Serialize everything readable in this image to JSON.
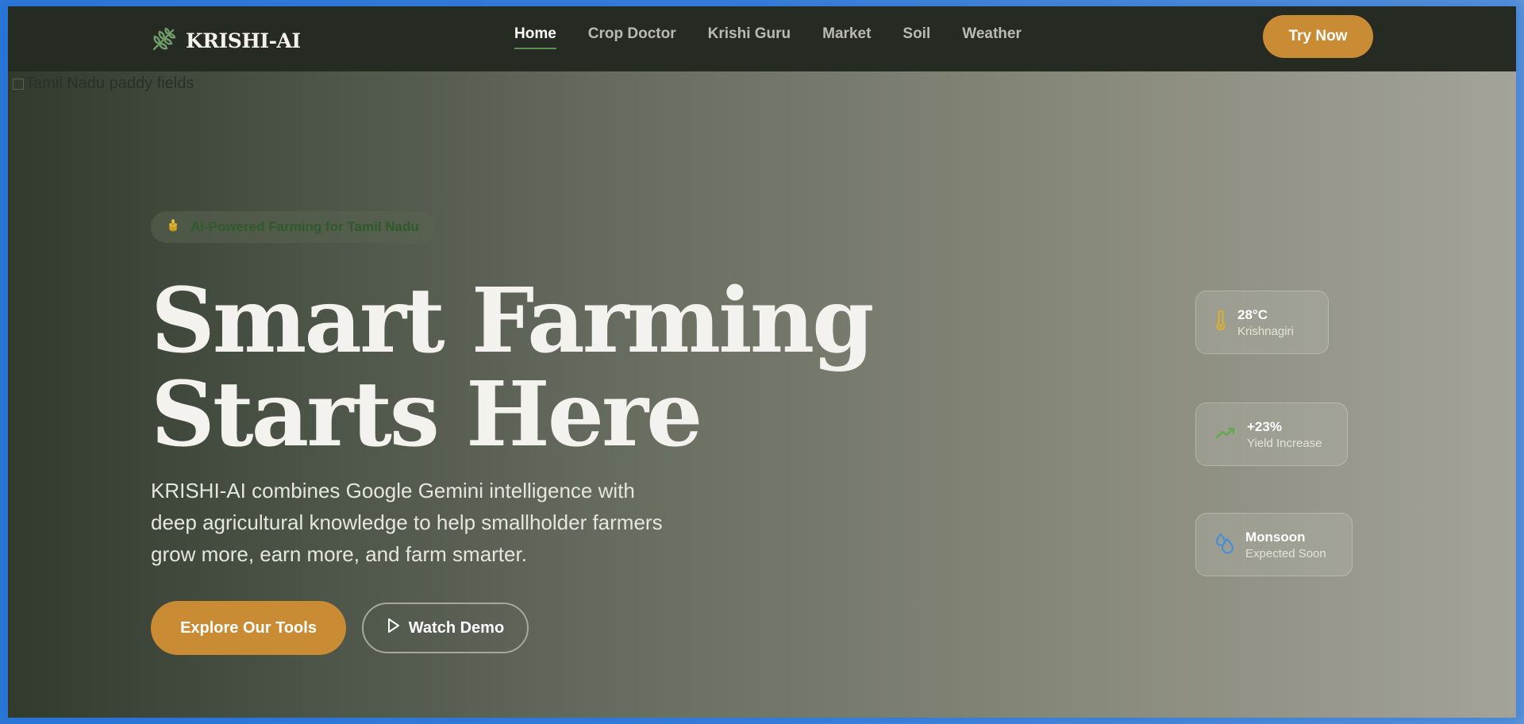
{
  "brand": {
    "name": "KRISHI-AI",
    "accent": "#c98c34",
    "green": "#5c8f4d",
    "nav_bg": "#252a22"
  },
  "nav": {
    "links": [
      {
        "label": "Home",
        "active": true
      },
      {
        "label": "Crop Doctor",
        "active": false
      },
      {
        "label": "Krishi Guru",
        "active": false
      },
      {
        "label": "Market",
        "active": false
      },
      {
        "label": "Soil",
        "active": false
      },
      {
        "label": "Weather",
        "active": false
      }
    ],
    "cta": "Try Now"
  },
  "hero_image_alt": "Tamil Nadu paddy fields",
  "hero": {
    "badge": "AI-Powered Farming for Tamil Nadu",
    "badge_icon": "wheat-icon",
    "headline_line1": "Smart Farming",
    "headline_line2": "Starts Here",
    "subtext": "KRISHI-AI combines Google Gemini intelligence with deep agricultural knowledge to help smallholder farmers grow more, earn more, and farm smarter.",
    "primary_button": "Explore Our Tools",
    "secondary_button": "Watch Demo"
  },
  "stats": [
    {
      "value": "28°C",
      "label": "Krishnagiri",
      "icon": "thermometer-icon",
      "color": "#e0b02a"
    },
    {
      "value": "+23%",
      "label": "Yield Increase",
      "icon": "trending-up-icon",
      "color": "#5caa4a"
    },
    {
      "value": "Monsoon",
      "label": "Expected Soon",
      "icon": "droplets-icon",
      "color": "#3f8ede"
    }
  ]
}
